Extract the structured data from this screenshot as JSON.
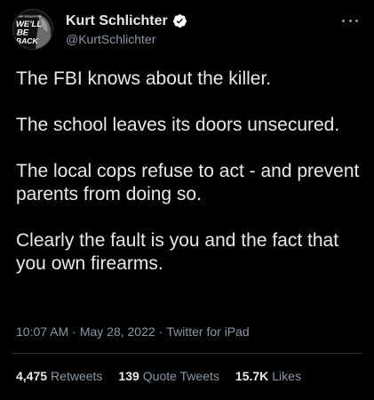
{
  "colors": {
    "background": "#000000",
    "text_primary": "#e7e9ea",
    "text_secondary": "#8b98a5",
    "verified_badge": "#ffffff",
    "divider": "#2f3336"
  },
  "author": {
    "display_name": "Kurt Schlichter",
    "handle": "@KurtSchlichter",
    "verified_icon": "verified-badge-icon",
    "avatar_text": [
      "KURT SCHLICHTER",
      "WE'LL",
      "BE",
      "BACK"
    ]
  },
  "tweet": {
    "paragraphs": [
      "The FBI knows about the killer.",
      "The school leaves its doors unsecured.",
      "The local cops refuse to act - and prevent parents from doing so.",
      "Clearly the fault is you and the fact that you own firearms."
    ],
    "time": "10:07 AM",
    "date": "May 28, 2022",
    "source": "Twitter for iPad",
    "separator": "·"
  },
  "stats": {
    "retweets": {
      "count": "4,475",
      "label": "Retweets"
    },
    "quote_tweets": {
      "count": "139",
      "label": "Quote Tweets"
    },
    "likes": {
      "count": "15.7K",
      "label": "Likes"
    }
  }
}
